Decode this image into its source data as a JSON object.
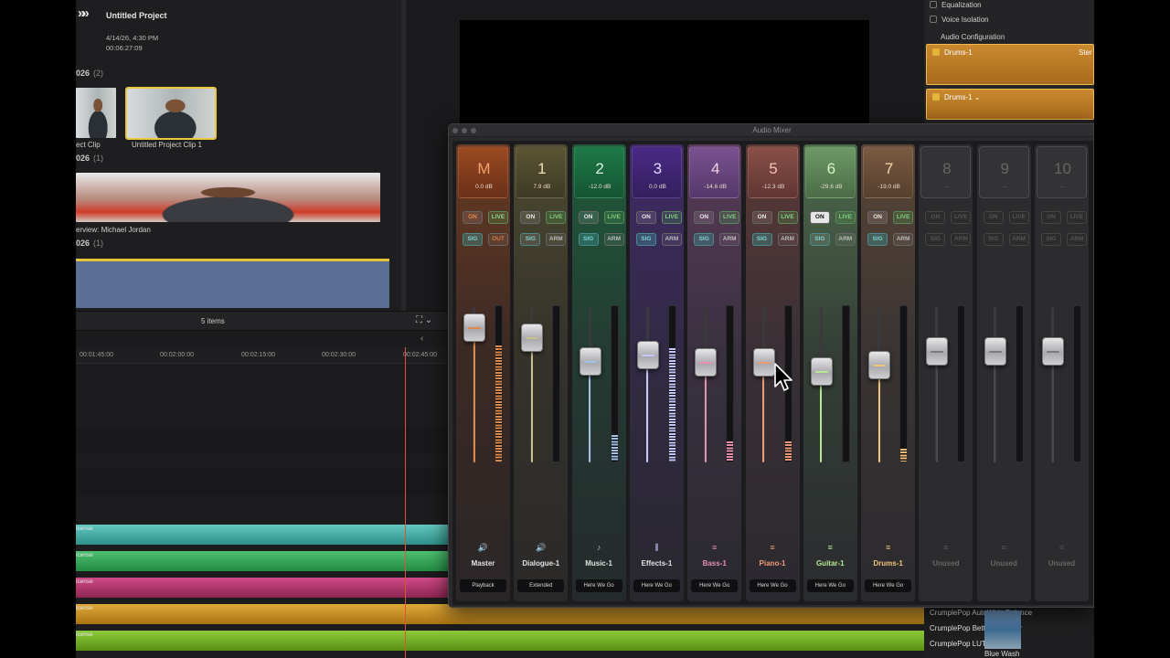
{
  "project": {
    "title": "Untitled Project",
    "date": "4/14/26, 4:30 PM",
    "duration": "00:06:27:09"
  },
  "browser": {
    "sections": [
      {
        "heading": "026",
        "count": "(2)"
      },
      {
        "heading": "026",
        "count": "(1)"
      },
      {
        "heading": "026",
        "count": "(1)"
      }
    ],
    "clips": {
      "clip1": "ect Clip",
      "clip2": "Untitled Project Clip 1",
      "clip3": "erview: Michael Jordan"
    },
    "items_count": "5 items"
  },
  "inspector": {
    "equalization": "Equalization",
    "voice_isolation": "Voice Isolation",
    "audio_config": "Audio Configuration",
    "lane1": "Drums-1",
    "lane1_right": "Ster",
    "lane2": "Drums-1"
  },
  "timeline": {
    "ticks": [
      "00:01:45:00",
      "00:02:00:00",
      "00:02:15:00",
      "00:02:30:00",
      "00:02:45:00"
    ],
    "track_names": [
      "icense",
      "icense",
      "icense",
      "icense",
      "icense"
    ]
  },
  "effects": {
    "items": [
      "CrumplePop AutoWhiteBalance",
      "CrumplePop BetterStabilizer",
      "CrumplePop LUTPro"
    ],
    "thumb_label": "Blue Wash"
  },
  "mixer": {
    "title": "Audio Mixer",
    "strips": [
      {
        "num": "M",
        "db": "0.0 dB",
        "b1": "ON",
        "b2": "LIVE",
        "b3": "SIG",
        "b4": "OUT",
        "icon": "speaker-icon",
        "glyph": "🔊",
        "name": "Master",
        "bottom": "Playback",
        "color": "#e0874a",
        "level": 0.96,
        "meter": 0.75
      },
      {
        "num": "1",
        "db": "7.9 dB",
        "b1": "ON",
        "b2": "LIVE",
        "b3": "SIG",
        "b4": "ARM",
        "icon": "speaker-icon",
        "glyph": "🔊",
        "name": "Dialogue-1",
        "bottom": "Extended",
        "color": "#c9c08a",
        "level": 0.88,
        "meter": 0.0
      },
      {
        "num": "2",
        "db": "-12.0 dB",
        "b1": "ON",
        "b2": "LIVE",
        "b3": "SIG",
        "b4": "ARM",
        "icon": "music-note-icon",
        "glyph": "♪",
        "name": "Music-1",
        "bottom": "Here We Go",
        "color": "#9fc3e8",
        "level": 0.68,
        "meter": 0.17
      },
      {
        "num": "3",
        "db": "0.0 dB",
        "b1": "ON",
        "b2": "LIVE",
        "b3": "SIG",
        "b4": "ARM",
        "icon": "waveform-icon",
        "glyph": "⫼",
        "name": "Effects-1",
        "bottom": "Here We Go",
        "color": "#c7c7ff",
        "level": 0.73,
        "meter": 0.73
      },
      {
        "num": "4",
        "db": "-14.6 dB",
        "b1": "ON",
        "b2": "LIVE",
        "b3": "SIG",
        "b4": "ARM",
        "icon": "sliders-icon",
        "glyph": "≡",
        "name": "Bass-1",
        "bottom": "Here We Go",
        "color": "#e88fb0",
        "level": 0.67,
        "meter": 0.13
      },
      {
        "num": "5",
        "db": "-12.3 dB",
        "b1": "ON",
        "b2": "LIVE",
        "b3": "SIG",
        "b4": "ARM",
        "icon": "sliders-icon",
        "glyph": "≡",
        "name": "Piano-1",
        "bottom": "Here We Go",
        "color": "#ef9a76",
        "level": 0.67,
        "meter": 0.13
      },
      {
        "num": "6",
        "db": "-29.6 dB",
        "b1": "ON",
        "b2": "LIVE",
        "b3": "SIG",
        "b4": "ARM",
        "icon": "sliders-icon",
        "glyph": "≡",
        "name": "Guitar-1",
        "bottom": "Here We Go",
        "color": "#b6e890",
        "level": 0.59,
        "meter": 0.0
      },
      {
        "num": "7",
        "db": "-19.0 dB",
        "b1": "ON",
        "b2": "LIVE",
        "b3": "SIG",
        "b4": "ARM",
        "icon": "sliders-icon",
        "glyph": "≡",
        "name": "Drums-1",
        "bottom": "Here We Go",
        "color": "#f0c37a",
        "level": 0.65,
        "meter": 0.08
      },
      {
        "num": "8",
        "db": "--",
        "b1": "ON",
        "b2": "LIVE",
        "b3": "SIG",
        "b4": "ARM",
        "icon": "sliders-icon",
        "glyph": "≡",
        "name": "Unused",
        "bottom": "",
        "color": "#7a7a7e",
        "level": 0.76,
        "meter": 0.0
      },
      {
        "num": "9",
        "db": "--",
        "b1": "ON",
        "b2": "LIVE",
        "b3": "SIG",
        "b4": "ARM",
        "icon": "sliders-icon",
        "glyph": "≡",
        "name": "Unused",
        "bottom": "",
        "color": "#7a7a7e",
        "level": 0.76,
        "meter": 0.0
      },
      {
        "num": "10",
        "db": "--",
        "b1": "ON",
        "b2": "LIVE",
        "b3": "SIG",
        "b4": "ARM",
        "icon": "sliders-icon",
        "glyph": "≡",
        "name": "Unused",
        "bottom": "",
        "color": "#7a7a7e",
        "level": 0.76,
        "meter": 0.0
      }
    ]
  }
}
